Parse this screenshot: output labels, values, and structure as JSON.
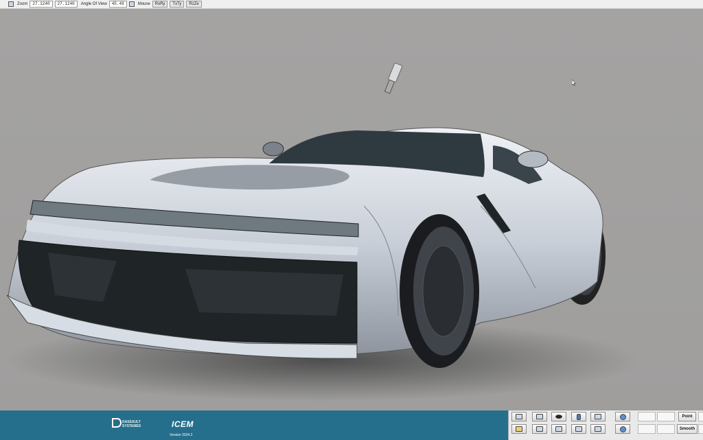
{
  "topbar": {
    "zoom_label": "Zoom",
    "zoom_value_1": "27.1240",
    "zoom_value_2": "27.1240",
    "angle_label": "Angle Of View",
    "angle_value": "45.49",
    "mouse_label": "Mouse",
    "mouse_buttons": [
      "RxRy",
      "TxTy",
      "RzZe"
    ]
  },
  "branding": {
    "company": "DASSAULT SYSTEMES",
    "product": "ICEM",
    "version": "Version 2024.2"
  },
  "toolpanel": {
    "point_label": "Point",
    "smooth_label": "Smooth"
  },
  "colors": {
    "viewport_bg": "#a2a1a0",
    "bottom_bar": "#256f8c",
    "car_body": "#c7ced8"
  }
}
